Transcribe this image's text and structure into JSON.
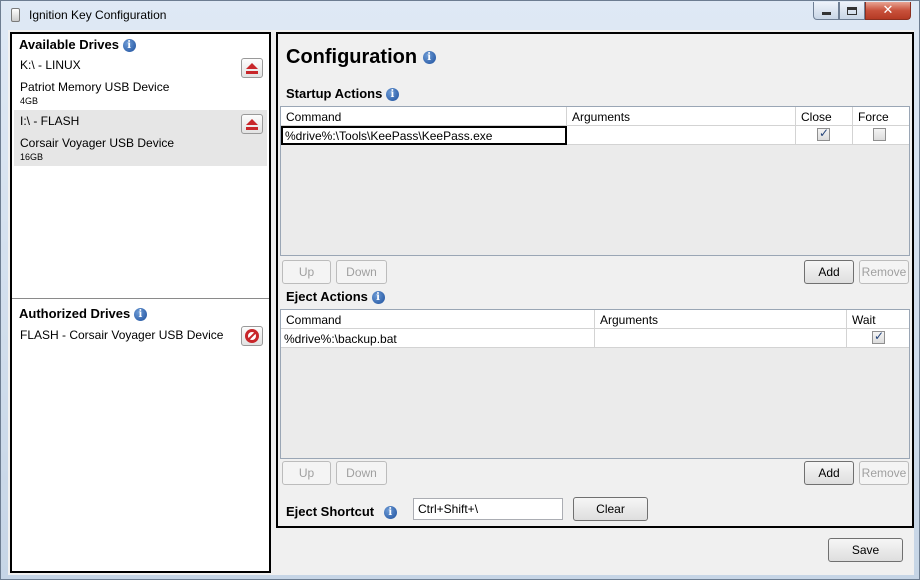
{
  "window": {
    "title": "Ignition Key Configuration"
  },
  "available_drives": {
    "title": "Available Drives",
    "items": [
      {
        "line1": "K:\\ - LINUX",
        "line2": "Patriot Memory USB Device",
        "size": "4GB"
      },
      {
        "line1": "I:\\ - FLASH",
        "line2": "Corsair Voyager USB Device",
        "size": "16GB"
      }
    ]
  },
  "authorized_drives": {
    "title": "Authorized Drives",
    "items": [
      {
        "label": "FLASH - Corsair Voyager USB Device"
      }
    ]
  },
  "configuration": {
    "title": "Configuration"
  },
  "startup_actions": {
    "title": "Startup Actions",
    "columns": [
      "Command",
      "Arguments",
      "Close",
      "Force"
    ],
    "rows": [
      {
        "command": "%drive%:\\Tools\\KeePass\\KeePass.exe",
        "arguments": "",
        "close": true,
        "force": false
      }
    ],
    "buttons": {
      "up": "Up",
      "down": "Down",
      "add": "Add",
      "remove": "Remove"
    }
  },
  "eject_actions": {
    "title": "Eject Actions",
    "columns": [
      "Command",
      "Arguments",
      "Wait"
    ],
    "rows": [
      {
        "command": "%drive%:\\backup.bat",
        "arguments": "",
        "wait": true
      }
    ],
    "buttons": {
      "up": "Up",
      "down": "Down",
      "add": "Add",
      "remove": "Remove"
    }
  },
  "eject_shortcut": {
    "label": "Eject Shortcut",
    "value": "Ctrl+Shift+\\",
    "clear_label": "Clear"
  },
  "footer": {
    "save_label": "Save"
  },
  "icons": {
    "info": "info-icon",
    "eject": "eject-icon",
    "remove": "forbid-icon"
  },
  "colors": {
    "accent_red": "#c8262a",
    "info_blue": "#1c4f9c"
  }
}
